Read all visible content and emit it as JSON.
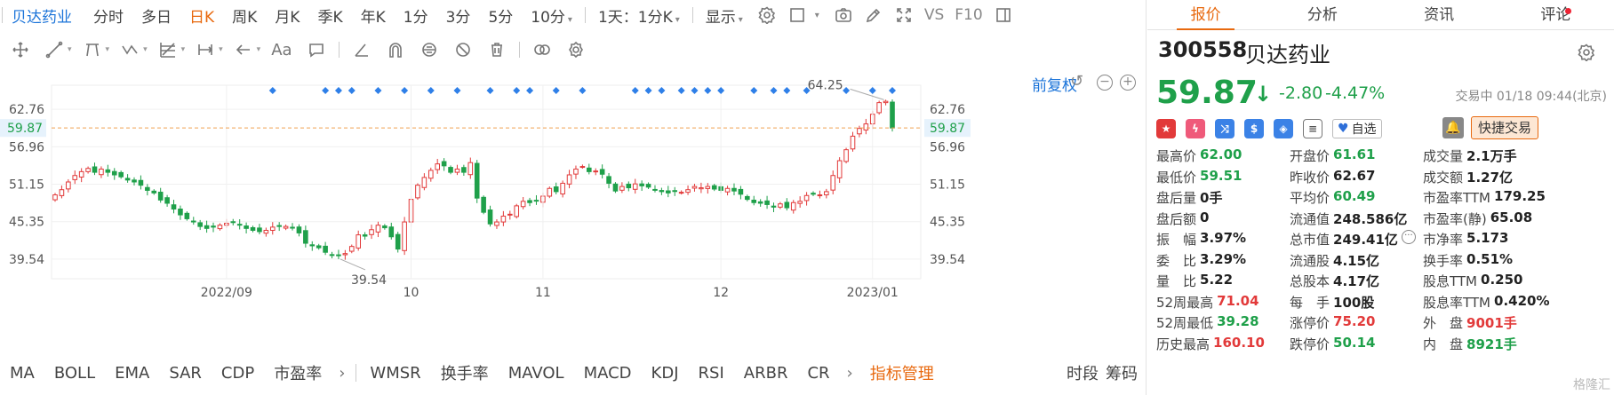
{
  "toolbar": {
    "stock_name": "贝达药业",
    "periods": [
      "分时",
      "多日",
      "日K",
      "周K",
      "月K",
      "季K",
      "年K",
      "1分",
      "3分",
      "5分",
      "10分"
    ],
    "active_period": "日K",
    "interval_select": "1天：1分K",
    "display_label": "显示",
    "vs_label": "VS",
    "f10_label": "F10"
  },
  "drawing_tools": {
    "text_tool_label": "Aa"
  },
  "chart": {
    "adjust_label": "前复权",
    "y_ticks": [
      "62.76",
      "56.96",
      "51.15",
      "45.35",
      "39.54"
    ],
    "current_price_label": "59.87",
    "high_marker": "64.25",
    "low_marker": "39.54",
    "x_labels": [
      "2022/09",
      "10",
      "11",
      "12",
      "2023/01"
    ],
    "colors": {
      "up": "#e23a3a",
      "down": "#1fa04a",
      "event": "#2e7fe8",
      "price_line": "#f0a050"
    }
  },
  "chart_data": {
    "type": "candlestick",
    "title": "",
    "ylim": [
      36.5,
      66.5
    ],
    "y_ticks": [
      62.76,
      56.96,
      51.15,
      45.35,
      39.54
    ],
    "current_price": 59.87,
    "high": 64.25,
    "low": 39.54,
    "x_tick_labels": [
      "2022/09",
      "10",
      "11",
      "12",
      "2023/01"
    ],
    "close": [
      49.5,
      50.3,
      51.5,
      52.5,
      53.1,
      53.6,
      53.0,
      53.5,
      53.0,
      52.6,
      52.3,
      51.8,
      51.5,
      51.0,
      50.2,
      49.8,
      48.7,
      48.2,
      47.3,
      46.4,
      45.8,
      45.3,
      44.6,
      44.3,
      44.5,
      44.8,
      45.1,
      45.3,
      44.8,
      44.3,
      44.0,
      43.8,
      44.0,
      44.5,
      44.7,
      44.6,
      44.4,
      43.6,
      42.0,
      41.6,
      41.3,
      40.6,
      40.2,
      40.1,
      40.4,
      41.5,
      43.3,
      43.1,
      44.1,
      44.8,
      44.4,
      43.0,
      41.1,
      45.3,
      48.8,
      51.0,
      52.2,
      53.3,
      54.3,
      54.0,
      53.0,
      53.5,
      53.0,
      54.5,
      49.0,
      46.8,
      45.0,
      45.3,
      46.2,
      46.5,
      47.8,
      48.5,
      48.3,
      48.6,
      49.3,
      50.5,
      50.0,
      51.3,
      52.6,
      53.5,
      53.9,
      53.1,
      53.2,
      52.7,
      51.3,
      50.1,
      50.8,
      50.6,
      51.2,
      50.9,
      50.7,
      50.3,
      50.0,
      49.8,
      50.1,
      49.9,
      50.3,
      50.8,
      50.6,
      50.8,
      50.4,
      50.2,
      50.5,
      50.1,
      49.6,
      48.8,
      48.3,
      48.2,
      48.0,
      47.6,
      48.1,
      47.5,
      48.3,
      48.5,
      49.4,
      49.6,
      49.5,
      50.0,
      52.5,
      54.8,
      56.5,
      58.6,
      59.8,
      60.5,
      62.0,
      63.8,
      64.0,
      59.87
    ],
    "event_markers": "diamond markers above candles"
  },
  "indicators": {
    "items": [
      "MA",
      "BOLL",
      "EMA",
      "SAR",
      "CDP",
      "市盈率",
      "WMSR",
      "换手率",
      "MAVOL",
      "MACD",
      "KDJ",
      "RSI",
      "ARBR",
      "CR"
    ],
    "manage_label": "指标管理",
    "right_items": [
      "时段",
      "筹码"
    ]
  },
  "panel": {
    "tabs": [
      "报价",
      "分析",
      "资讯",
      "评论"
    ],
    "active_tab": "报价",
    "code": "300558",
    "name": "贝达药业",
    "price": "59.87",
    "change": "-2.80",
    "change_pct": "-4.47%",
    "trade_time": "交易中 01/18 09:44(北京)",
    "fav_label": "自选",
    "quick_trade_label": "快捷交易",
    "stats": [
      [
        {
          "label": "最高价",
          "value": "62.00",
          "tone": "dn"
        },
        {
          "label": "开盘价",
          "value": "61.61",
          "tone": "dn"
        },
        {
          "label": "成交量",
          "value": "2.1万手",
          "tone": ""
        }
      ],
      [
        {
          "label": "最低价",
          "value": "59.51",
          "tone": "dn"
        },
        {
          "label": "昨收价",
          "value": "62.67",
          "tone": ""
        },
        {
          "label": "成交额",
          "value": "1.27亿",
          "tone": ""
        }
      ],
      [
        {
          "label": "盘后量",
          "value": "0手",
          "tone": ""
        },
        {
          "label": "平均价",
          "value": "60.49",
          "tone": "dn"
        },
        {
          "label": "市盈率TTM",
          "value": "179.25",
          "tone": ""
        }
      ],
      [
        {
          "label": "盘后额",
          "value": "0",
          "tone": ""
        },
        {
          "label": "流通值",
          "value": "248.586亿",
          "tone": ""
        },
        {
          "label": "市盈率(静)",
          "value": "65.08",
          "tone": ""
        }
      ],
      [
        {
          "label": "振　幅",
          "value": "3.97%",
          "tone": ""
        },
        {
          "label": "总市值",
          "value": "249.41亿",
          "tone": ""
        },
        {
          "label": "市净率",
          "value": "5.173",
          "tone": ""
        }
      ],
      [
        {
          "label": "委　比",
          "value": "3.29%",
          "tone": ""
        },
        {
          "label": "流通股",
          "value": "4.15亿",
          "tone": ""
        },
        {
          "label": "换手率",
          "value": "0.51%",
          "tone": ""
        }
      ],
      [
        {
          "label": "量　比",
          "value": "5.22",
          "tone": ""
        },
        {
          "label": "总股本",
          "value": "4.17亿",
          "tone": ""
        },
        {
          "label": "股息TTM",
          "value": "0.250",
          "tone": ""
        }
      ],
      [
        {
          "label": "52周最高",
          "value": "71.04",
          "tone": "up"
        },
        {
          "label": "每　手",
          "value": "100股",
          "tone": ""
        },
        {
          "label": "股息率TTM",
          "value": "0.420%",
          "tone": ""
        }
      ],
      [
        {
          "label": "52周最低",
          "value": "39.28",
          "tone": "dn"
        },
        {
          "label": "涨停价",
          "value": "75.20",
          "tone": "up"
        },
        {
          "label": "外　盘",
          "value": "9001手",
          "tone": "up"
        }
      ],
      [
        {
          "label": "历史最高",
          "value": "160.10",
          "tone": "up"
        },
        {
          "label": "跌停价",
          "value": "50.14",
          "tone": "dn"
        },
        {
          "label": "内　盘",
          "value": "8921手",
          "tone": "dn"
        }
      ]
    ],
    "watermark": "格隆汇"
  }
}
